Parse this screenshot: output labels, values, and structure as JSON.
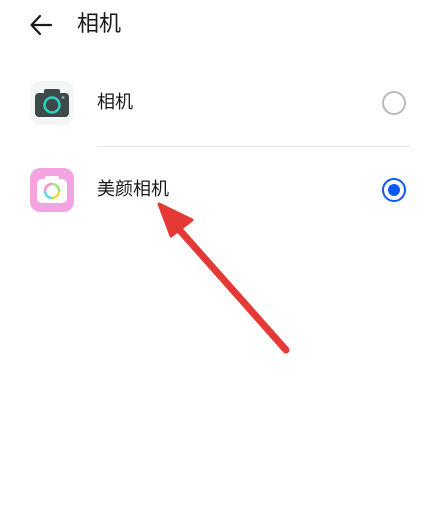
{
  "header": {
    "back_icon": "arrow-left-icon",
    "title": "相机"
  },
  "options": [
    {
      "label": "相机",
      "icon": "camera-app-icon",
      "selected": false
    },
    {
      "label": "美颜相机",
      "icon": "beauty-camera-app-icon",
      "selected": true
    }
  ],
  "colors": {
    "accent": "#0a59f7",
    "annotation_arrow": "#e53935",
    "camera_icon_body": "#3d4a4c",
    "camera_icon_lens": "#2fd0b8",
    "beauty_icon_bg": "#f3a3e0"
  }
}
